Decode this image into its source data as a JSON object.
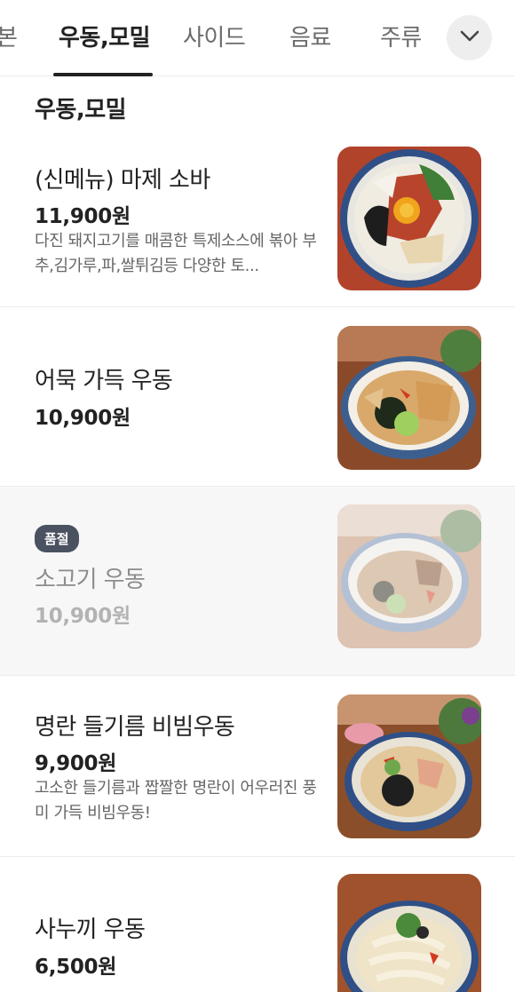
{
  "tabs": [
    {
      "label": "본"
    },
    {
      "label": "우동,모밀",
      "active": true
    },
    {
      "label": "사이드"
    },
    {
      "label": "음료"
    },
    {
      "label": "주류"
    }
  ],
  "tab_more_icon": "chevron-down-icon",
  "section": {
    "title": "우동,모밀"
  },
  "items": [
    {
      "name": "(신메뉴) 마제 소바",
      "price": "11,900원",
      "description": "다진 돼지고기를 매콤한 특제소스에 볶아 부추,김가루,파,쌀튀김등 다양한 토...",
      "image": "mazesoba-photo"
    },
    {
      "name": "어묵 가득 우동",
      "price": "10,900원",
      "image": "fishcake-udon-photo"
    },
    {
      "badge": "품절",
      "name": "소고기 우동",
      "price": "10,900원",
      "image": "beef-udon-photo"
    },
    {
      "name": "명란 들기름 비빔우동",
      "price": "9,900원",
      "description": "고소한 들기름과 짭짤한 명란이 어우러진 풍미 가득 비빔우동!",
      "image": "myeongran-bibim-udon-photo"
    },
    {
      "name": "사누끼 우동",
      "price": "6,500원",
      "image": "sanuki-udon-photo"
    }
  ],
  "colors": {
    "text": "#222222",
    "muted": "#666666",
    "divider": "#ececec",
    "badge_bg": "#4a5160",
    "soldout_bg": "#f7f7f8"
  }
}
